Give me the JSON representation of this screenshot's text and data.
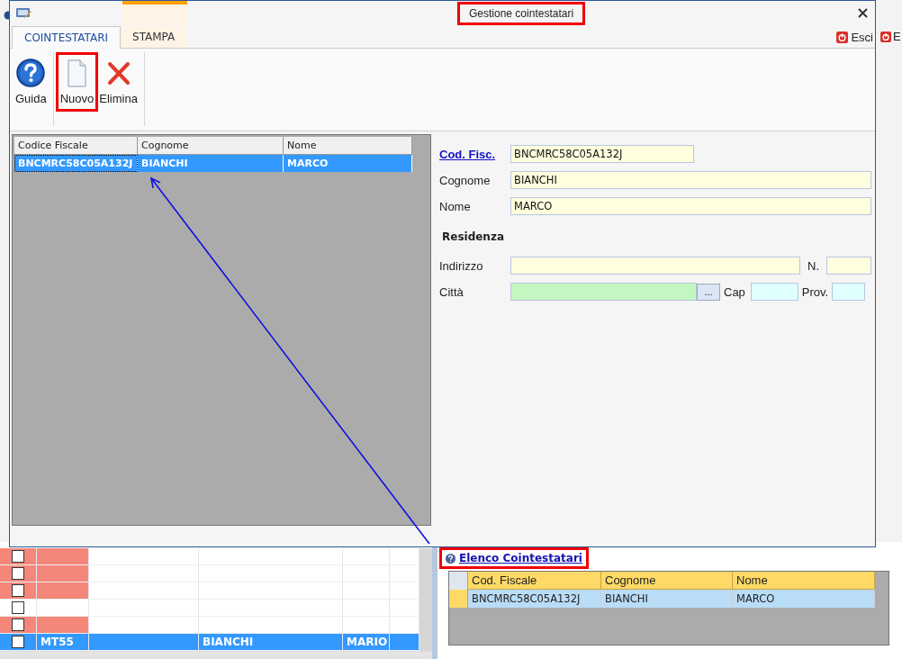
{
  "window": {
    "title": "Gestione cointestatari",
    "highlighted": true
  },
  "tabs": [
    {
      "label": "COINTESTATARI",
      "selected": true,
      "kind": "normal"
    },
    {
      "label": "STAMPA",
      "selected": false,
      "kind": "contextual"
    }
  ],
  "exit_button": {
    "label": "Esci"
  },
  "toolbar": [
    {
      "label": "Guida",
      "kind": "help",
      "highlighted": false
    },
    {
      "label": "Nuovo",
      "kind": "new",
      "highlighted": true
    },
    {
      "label": "Elimina",
      "kind": "delete",
      "highlighted": false
    }
  ],
  "list": {
    "columns": [
      "Codice Fiscale",
      "Cognome",
      "Nome"
    ],
    "rows": [
      {
        "cells": [
          "BNCMRC58C05A132J",
          "BIANCHI",
          "MARCO"
        ],
        "selected": true
      }
    ]
  },
  "form": {
    "cod_fisc": {
      "label": "Cod. Fisc.",
      "value": "BNCMRC58C05A132J"
    },
    "cognome": {
      "label": "Cognome",
      "value": "BIANCHI"
    },
    "nome": {
      "label": "Nome",
      "value": "MARCO"
    },
    "section": "Residenza",
    "indirizzo": {
      "label": "Indirizzo"
    },
    "numero": {
      "label": "N."
    },
    "citta": {
      "label": "Città",
      "button": "..."
    },
    "cap": {
      "label": "Cap"
    },
    "prov": {
      "label": "Prov."
    }
  },
  "background": {
    "exit_label": "E",
    "grid_rows": [
      {
        "checked": false,
        "flagged": true,
        "selected": false
      },
      {
        "checked": false,
        "flagged": true,
        "selected": false
      },
      {
        "checked": false,
        "flagged": true,
        "selected": false
      },
      {
        "checked": false,
        "flagged": false,
        "selected": false
      },
      {
        "checked": false,
        "flagged": true,
        "selected": false
      },
      {
        "checked": false,
        "flagged": false,
        "selected": true,
        "code": "MT55",
        "cognome": "BIANCHI",
        "nome": "MARIO"
      }
    ],
    "link": {
      "label": "Elenco Cointestatari",
      "highlighted": true
    },
    "grid": {
      "columns": [
        "Cod. Fiscale",
        "Cognome",
        "Nome"
      ],
      "rows": [
        {
          "cells": [
            "BNCMRC58C05A132J",
            "BIANCHI",
            "MARCO"
          ],
          "selected": true
        }
      ]
    }
  }
}
